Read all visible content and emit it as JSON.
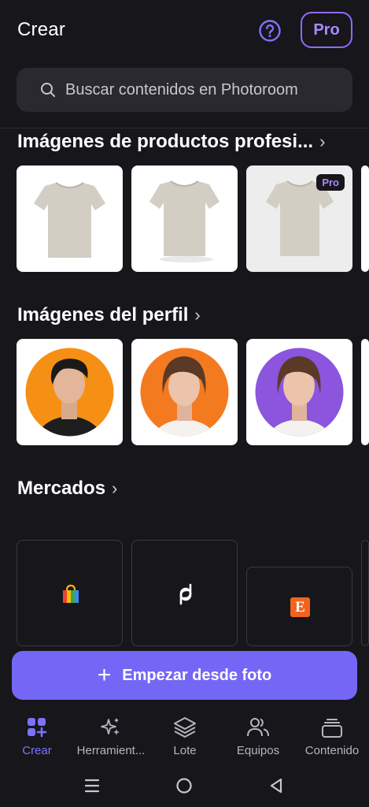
{
  "header": {
    "title": "Crear",
    "pro_label": "Pro"
  },
  "search": {
    "placeholder": "Buscar contenidos en Photoroom"
  },
  "sections": [
    {
      "title": "Imágenes de productos profesi...",
      "pro_badge": "Pro"
    },
    {
      "title": "Imágenes del perfil"
    },
    {
      "title": "Mercados"
    }
  ],
  "cta": {
    "label": "Empezar desde foto"
  },
  "tabs": [
    {
      "label": "Crear",
      "icon": "create-icon"
    },
    {
      "label": "Herramient...",
      "icon": "sparkles-icon"
    },
    {
      "label": "Lote",
      "icon": "layers-icon"
    },
    {
      "label": "Equipos",
      "icon": "team-icon"
    },
    {
      "label": "Contenido",
      "icon": "stack-icon"
    }
  ],
  "marketplaces": [
    {
      "icon": "shopping-bag-icon"
    },
    {
      "icon": "depop-icon"
    },
    {
      "icon": "etsy-icon",
      "letter": "E"
    }
  ],
  "colors": {
    "accent": "#7467f5",
    "pro": "#a98bff",
    "background": "#17161b",
    "orange": "#f4801e",
    "purple": "#8b55dd",
    "etsy": "#f1641e"
  }
}
